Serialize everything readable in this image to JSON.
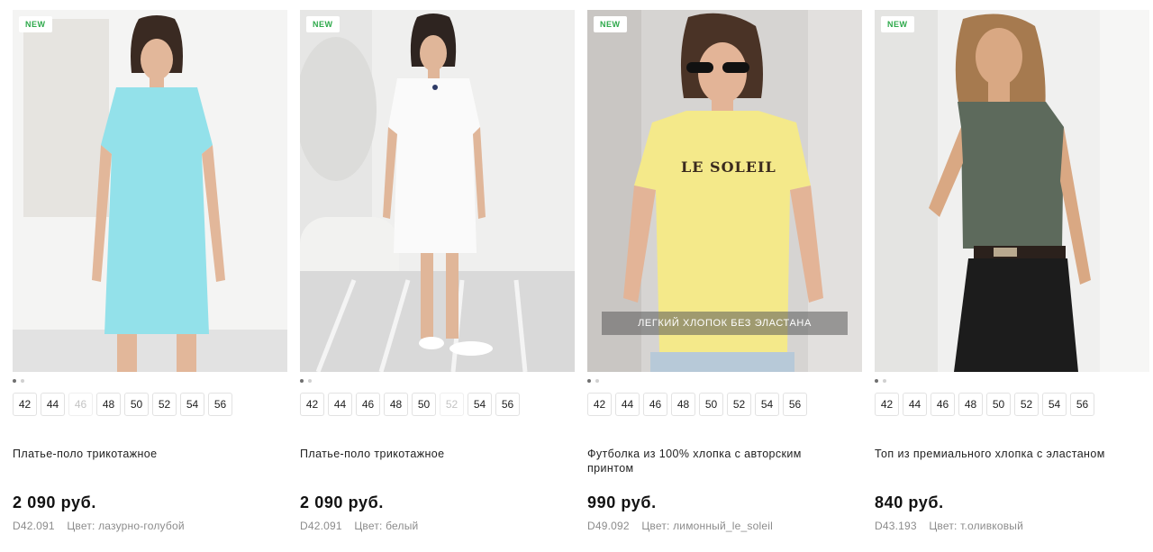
{
  "badge_label": "NEW",
  "products": [
    {
      "title": "Платье-поло трикотажное",
      "price": "2 090 руб.",
      "article": "D42.091",
      "color_label": "Цвет: лазурно-голубой",
      "overlay": "",
      "sizes": [
        {
          "label": "42",
          "available": true
        },
        {
          "label": "44",
          "available": true
        },
        {
          "label": "46",
          "available": false
        },
        {
          "label": "48",
          "available": true
        },
        {
          "label": "50",
          "available": true
        },
        {
          "label": "52",
          "available": true
        },
        {
          "label": "54",
          "available": true
        },
        {
          "label": "56",
          "available": true
        }
      ],
      "garment_color": "#93e1ea",
      "background": "#ededed"
    },
    {
      "title": "Платье-поло трикотажное",
      "price": "2 090 руб.",
      "article": "D42.091",
      "color_label": "Цвет: белый",
      "overlay": "",
      "sizes": [
        {
          "label": "42",
          "available": true
        },
        {
          "label": "44",
          "available": true
        },
        {
          "label": "46",
          "available": true
        },
        {
          "label": "48",
          "available": true
        },
        {
          "label": "50",
          "available": true
        },
        {
          "label": "52",
          "available": false
        },
        {
          "label": "54",
          "available": true
        },
        {
          "label": "56",
          "available": true
        }
      ],
      "garment_color": "#fafafa",
      "background": "#e4e4e4"
    },
    {
      "title": "Футболка из 100% хлопка с авторским принтом",
      "price": "990 руб.",
      "article": "D49.092",
      "color_label": "Цвет: лимонный_le_soleil",
      "overlay": "ЛЕГКИЙ ХЛОПОК БЕЗ ЭЛАСТАНА",
      "print_text": "LE SOLEIL",
      "sizes": [
        {
          "label": "42",
          "available": true
        },
        {
          "label": "44",
          "available": true
        },
        {
          "label": "46",
          "available": true
        },
        {
          "label": "48",
          "available": true
        },
        {
          "label": "50",
          "available": true
        },
        {
          "label": "52",
          "available": true
        },
        {
          "label": "54",
          "available": true
        },
        {
          "label": "56",
          "available": true
        }
      ],
      "garment_color": "#f4e98a",
      "background": "#d8d6d4"
    },
    {
      "title": "Топ из премиального хлопка с эластаном",
      "price": "840 руб.",
      "article": "D43.193",
      "color_label": "Цвет: т.оливковый",
      "overlay": "",
      "sizes": [
        {
          "label": "42",
          "available": true
        },
        {
          "label": "44",
          "available": true
        },
        {
          "label": "46",
          "available": true
        },
        {
          "label": "48",
          "available": true
        },
        {
          "label": "50",
          "available": true
        },
        {
          "label": "52",
          "available": true
        },
        {
          "label": "54",
          "available": true
        },
        {
          "label": "56",
          "available": true
        }
      ],
      "garment_color": "#5d6a5c",
      "background": "#eeeeec"
    }
  ],
  "colors": {
    "badge_text": "#2ea94b",
    "price": "#111111",
    "meta": "#8c8c8c",
    "size_disabled": "#c4c4c4"
  }
}
